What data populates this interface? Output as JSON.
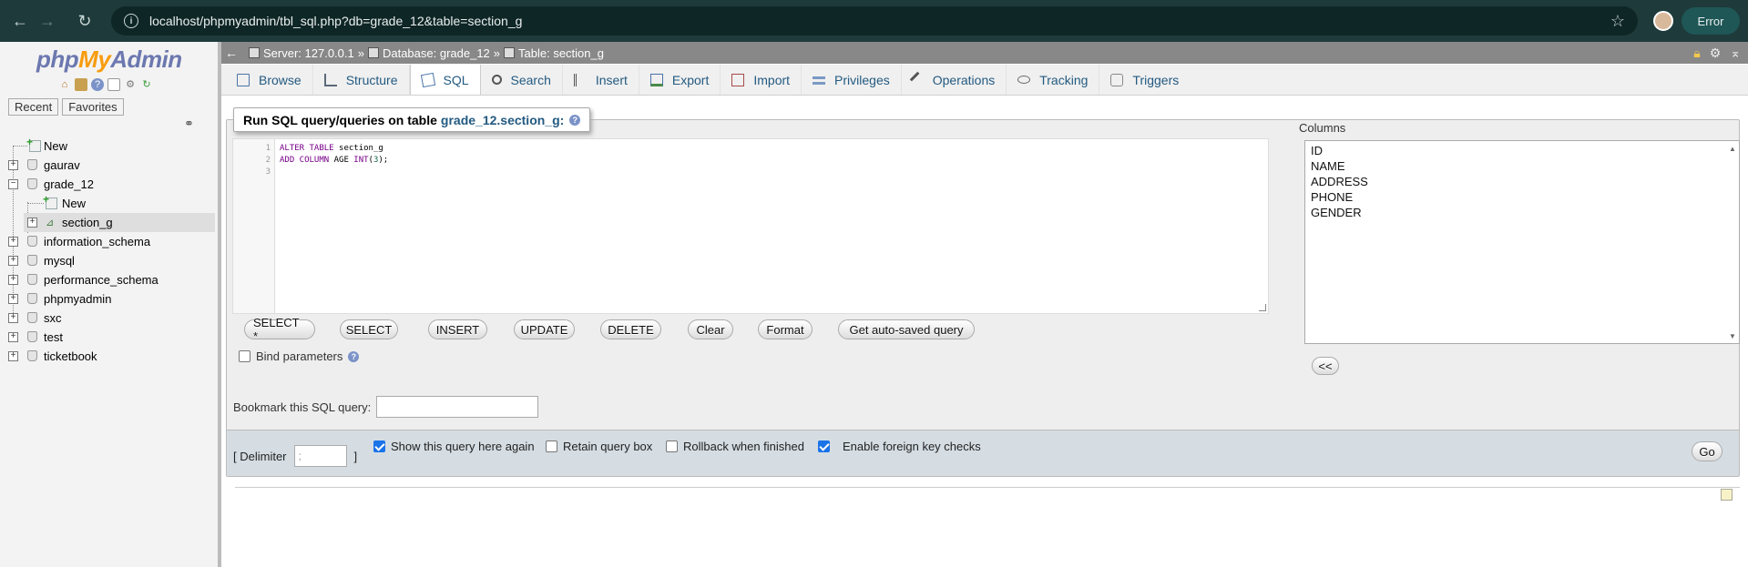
{
  "browser": {
    "url": "localhost/phpmyadmin/tbl_sql.php?db=grade_12&table=section_g",
    "status_label": "Error"
  },
  "sidebar": {
    "logo": {
      "php": "php",
      "my": "My",
      "admin": "Admin"
    },
    "recent_label": "Recent",
    "favorites_label": "Favorites",
    "tree": [
      {
        "label": "New",
        "level": 0,
        "type": "new"
      },
      {
        "label": "gaurav",
        "level": 0,
        "type": "db"
      },
      {
        "label": "grade_12",
        "level": 0,
        "type": "db",
        "expanded": true
      },
      {
        "label": "New",
        "level": 1,
        "type": "new"
      },
      {
        "label": "section_g",
        "level": 1,
        "type": "table",
        "selected": true
      },
      {
        "label": "information_schema",
        "level": 0,
        "type": "db"
      },
      {
        "label": "mysql",
        "level": 0,
        "type": "db"
      },
      {
        "label": "performance_schema",
        "level": 0,
        "type": "db"
      },
      {
        "label": "phpmyadmin",
        "level": 0,
        "type": "db"
      },
      {
        "label": "sxc",
        "level": 0,
        "type": "db"
      },
      {
        "label": "test",
        "level": 0,
        "type": "db"
      },
      {
        "label": "ticketbook",
        "level": 0,
        "type": "db"
      }
    ]
  },
  "breadcrumb": {
    "server": "Server: 127.0.0.1",
    "database": "Database: grade_12",
    "table": "Table: section_g",
    "sep": "»"
  },
  "tabs": [
    {
      "label": "Browse",
      "icon": "browse-icon"
    },
    {
      "label": "Structure",
      "icon": "structure-icon"
    },
    {
      "label": "SQL",
      "icon": "sql-icon",
      "active": true
    },
    {
      "label": "Search",
      "icon": "search-icon"
    },
    {
      "label": "Insert",
      "icon": "insert-icon"
    },
    {
      "label": "Export",
      "icon": "export-icon"
    },
    {
      "label": "Import",
      "icon": "import-icon"
    },
    {
      "label": "Privileges",
      "icon": "privileges-icon"
    },
    {
      "label": "Operations",
      "icon": "operations-icon"
    },
    {
      "label": "Tracking",
      "icon": "tracking-icon"
    },
    {
      "label": "Triggers",
      "icon": "triggers-icon"
    }
  ],
  "query_panel": {
    "title": "Run SQL query/queries on table",
    "table_name": "grade_12.section_g:",
    "line_numbers": [
      "1",
      "2",
      "3"
    ],
    "code_lines": [
      [
        {
          "t": "ALTER TABLE",
          "c": "kw"
        },
        {
          "t": " section_g",
          "c": ""
        }
      ],
      [
        {
          "t": "ADD COLUMN",
          "c": "kw"
        },
        {
          "t": " AGE ",
          "c": ""
        },
        {
          "t": "INT",
          "c": "kw"
        },
        {
          "t": "(",
          "c": ""
        },
        {
          "t": "3",
          "c": "num"
        },
        {
          "t": ");",
          "c": ""
        }
      ],
      []
    ],
    "buttons": [
      "SELECT *",
      "SELECT",
      "INSERT",
      "UPDATE",
      "DELETE",
      "Clear",
      "Format",
      "Get auto-saved query"
    ],
    "bind_parameters": "Bind parameters",
    "bookmark_label": "Bookmark this SQL query:"
  },
  "columns": {
    "label": "Columns",
    "items": [
      "ID",
      "NAME",
      "ADDRESS",
      "PHONE",
      "GENDER"
    ],
    "insert_button": "<<"
  },
  "footer": {
    "delimiter_open": "[ Delimiter",
    "delimiter_value": ";",
    "delimiter_close": "]",
    "show_query_again": {
      "label": "Show this query here again",
      "checked": true
    },
    "retain_query_box": {
      "label": "Retain query box",
      "checked": false
    },
    "rollback": {
      "label": "Rollback when finished",
      "checked": false
    },
    "foreign_key_checks": {
      "label": "Enable foreign key checks",
      "checked": true
    },
    "go_button": "Go"
  },
  "colors": {
    "chrome_bg": "#1e3a3a",
    "link_blue": "#235a81",
    "topbar_bg": "#888888",
    "footer_bg": "#d5dde3"
  }
}
